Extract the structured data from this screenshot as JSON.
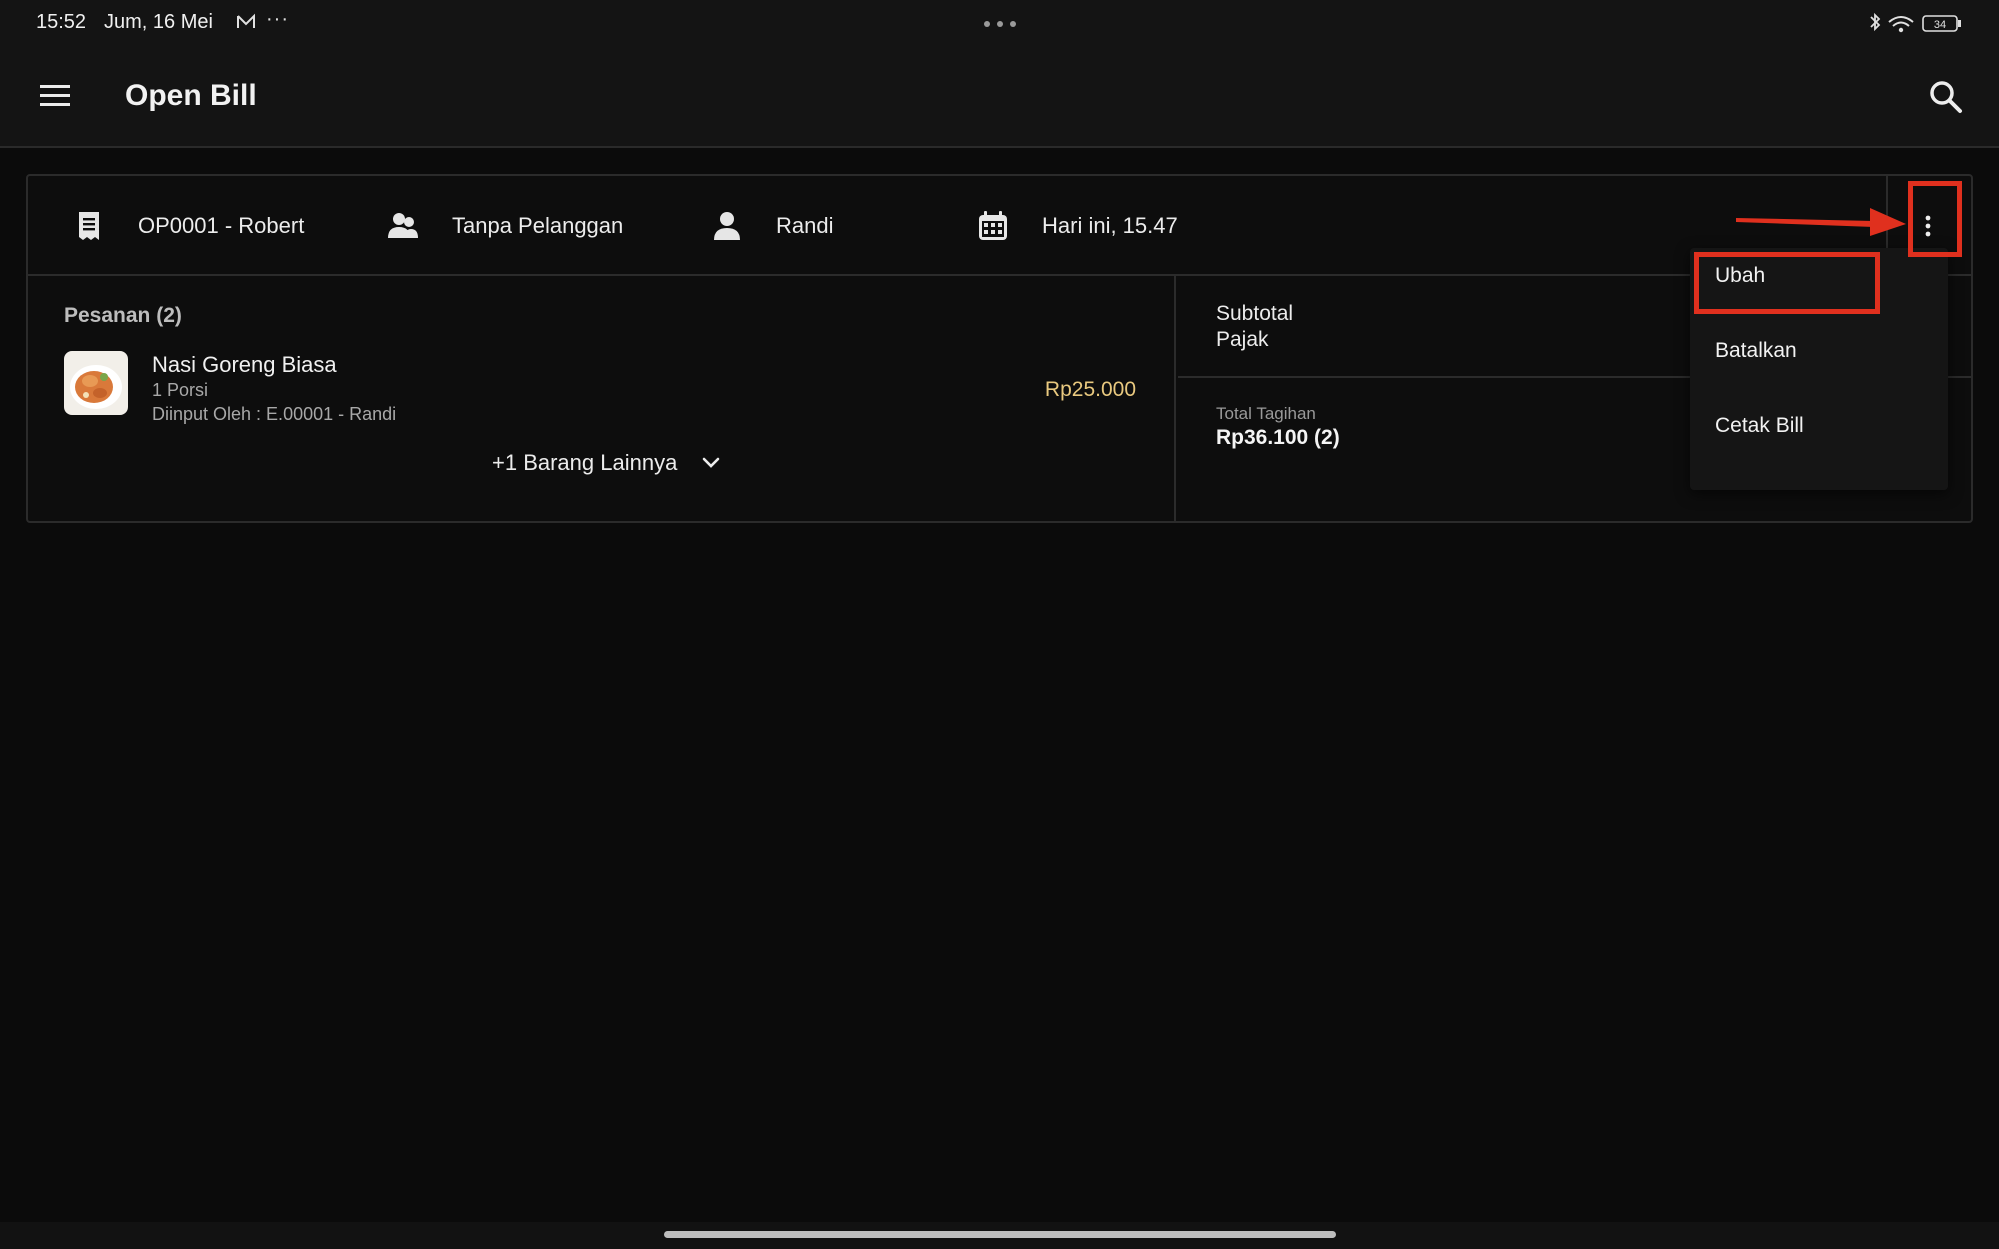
{
  "status_bar": {
    "time": "15:52",
    "date": "Jum, 16 Mei",
    "more": "···",
    "battery": "34"
  },
  "app_bar": {
    "title": "Open Bill"
  },
  "bill": {
    "id_name": "OP0001 - Robert",
    "customer": "Tanpa Pelanggan",
    "staff": "Randi",
    "time": "Hari ini, 15.47"
  },
  "orders": {
    "label": "Pesanan (2)",
    "item": {
      "name": "Nasi Goreng Biasa",
      "qty": "1 Porsi",
      "entered_by": "Diinput Oleh  : E.00001 - Randi",
      "price": "Rp25.000"
    },
    "more_label": "+1 Barang Lainnya"
  },
  "summary": {
    "subtotal_label": "Subtotal",
    "tax_label": "Pajak",
    "total_label": "Total Tagihan",
    "total_value": "Rp36.100 (2)"
  },
  "menu": {
    "items": [
      "Ubah",
      "Batalkan",
      "Cetak Bill"
    ]
  },
  "colors": {
    "background": "#0b0b0b",
    "accent_price": "#e9c97f",
    "annotation": "#e0301e"
  }
}
